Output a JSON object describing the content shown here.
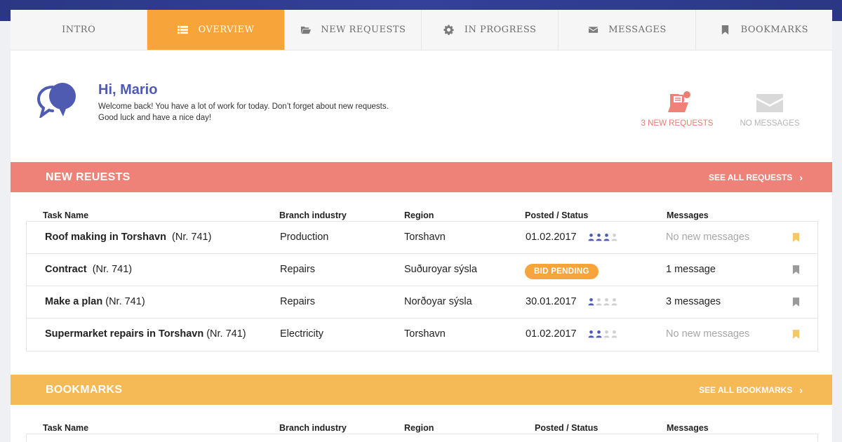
{
  "tabs": [
    {
      "label": "INTRO",
      "icon": "",
      "active": false
    },
    {
      "label": "OVERVIEW",
      "icon": "list-icon",
      "active": true
    },
    {
      "label": "NEW REQUESTS",
      "icon": "folder-icon",
      "active": false
    },
    {
      "label": "IN PROGRESS",
      "icon": "gear-icon",
      "active": false
    },
    {
      "label": "MESSAGES",
      "icon": "envelope-icon",
      "active": false
    },
    {
      "label": "BOOKMARKS",
      "icon": "bookmark-icon",
      "active": false
    }
  ],
  "welcome": {
    "greeting": "Hi, Mario",
    "line1": "Welcome back! You have a lot of work for today. Don’t forget about new requests.",
    "line2": "Good luck and have a nice day!",
    "requests_stat": "3 NEW REQUESTS",
    "messages_stat": "NO MESSAGES"
  },
  "new_requests": {
    "title": "NEW REUESTS",
    "see_all": "SEE ALL REQUESTS",
    "columns": [
      "Task Name",
      "Branch industry",
      "Region",
      "Posted / Status",
      "Messages"
    ],
    "rows": [
      {
        "task": "Roof making in Torshavn",
        "nr": "(Nr. 741)",
        "branch": "Production",
        "region": "Torshavn",
        "posted": "01.02.2017",
        "status": "",
        "rating": 3,
        "messages": "No new messages",
        "messages_muted": true,
        "bookmarked": true
      },
      {
        "task": "Contract",
        "nr": "(Nr. 741)",
        "branch": "Repairs",
        "region": "Suðuroyar sýsla",
        "posted": "",
        "status": "BID PENDING",
        "rating": 0,
        "messages": "1 message",
        "messages_muted": false,
        "bookmarked": false
      },
      {
        "task": "Make a plan",
        "nr": "(Nr. 741)",
        "branch": "Repairs",
        "region": "Norðoyar sýsla",
        "posted": "30.01.2017",
        "status": "",
        "rating": 1,
        "messages": "3 messages",
        "messages_muted": false,
        "bookmarked": false
      },
      {
        "task": "Supermarket repairs in Torshavn",
        "nr": "(Nr. 741)",
        "branch": "Electricity",
        "region": "Torshavn",
        "posted": "01.02.2017",
        "status": "",
        "rating": 2,
        "messages": "No new messages",
        "messages_muted": true,
        "bookmarked": true
      }
    ]
  },
  "bookmarks": {
    "title": "BOOKMARKS",
    "see_all": "SEE ALL BOOKMARKS",
    "columns": [
      "Task Name",
      "Branch industry",
      "Region",
      "Posted / Status",
      "Messages"
    ]
  },
  "colors": {
    "accent_orange": "#f7a53b",
    "red_bar": "#ee8278",
    "yellow_bar": "#f5b955",
    "brand_blue": "#4f5bb1",
    "bookmark_active": "#f7c66a",
    "bookmark_inactive": "#9a9a9a"
  }
}
